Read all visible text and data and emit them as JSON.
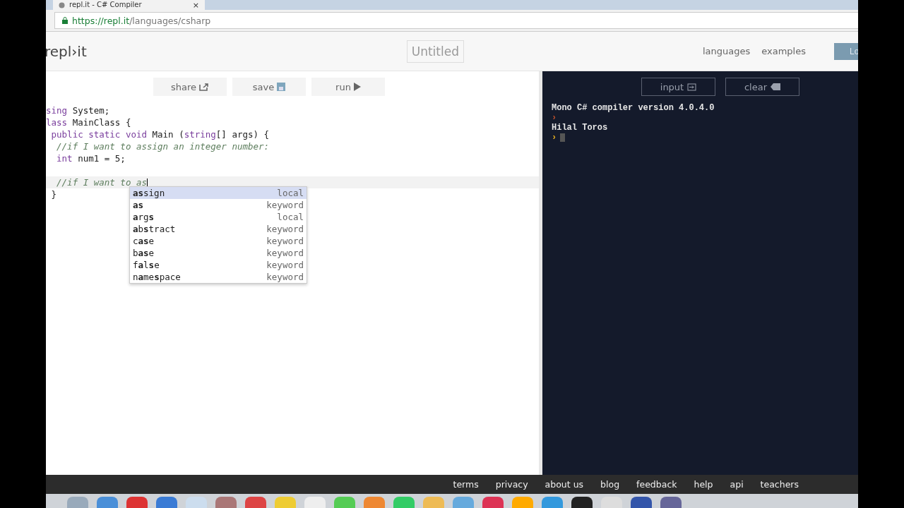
{
  "browser": {
    "tab_title": "repl.it - C# Compiler",
    "tab_close": "×",
    "url_host": "https://repl.it",
    "url_path": "/languages/csharp"
  },
  "header": {
    "logo": "repl›it",
    "title": "Untitled",
    "nav": [
      "languages",
      "examples"
    ],
    "login": "Lo"
  },
  "toolbar": [
    "share",
    "save",
    "run"
  ],
  "editor": {
    "lines": [
      {
        "kind": "code",
        "active": false,
        "tokens": [
          {
            "text": "sing",
            "kind": "keyword"
          },
          {
            "text": " System;",
            "kind": "plain"
          }
        ]
      },
      {
        "kind": "code",
        "active": false,
        "tokens": [
          {
            "text": "lass",
            "kind": "keyword"
          },
          {
            "text": " MainClass {",
            "kind": "plain"
          }
        ]
      },
      {
        "kind": "code",
        "active": false,
        "tokens": [
          {
            "text": " public static void",
            "kind": "keyword"
          },
          {
            "text": " Main (",
            "kind": "plain"
          },
          {
            "text": "string",
            "kind": "type"
          },
          {
            "text": "[] args) {",
            "kind": "plain"
          }
        ]
      },
      {
        "kind": "code",
        "active": false,
        "tokens": [
          {
            "text": "  //if I want to assign an integer number:",
            "kind": "comment"
          }
        ]
      },
      {
        "kind": "code",
        "active": false,
        "tokens": [
          {
            "text": "  int",
            "kind": "keyword"
          },
          {
            "text": " num1 = 5;",
            "kind": "plain"
          }
        ]
      },
      {
        "kind": "blank",
        "active": false
      },
      {
        "kind": "code",
        "active": true,
        "tokens": [
          {
            "text": "  //if I want to as",
            "kind": "comment"
          }
        ]
      },
      {
        "kind": "code",
        "active": false,
        "tokens": [
          {
            "text": " }",
            "kind": "plain"
          }
        ]
      }
    ],
    "completions": [
      {
        "label": "**as**sign",
        "type": "local",
        "selected": true
      },
      {
        "label": "**as**",
        "type": "keyword",
        "selected": false
      },
      {
        "label": "**a**rg**s**",
        "type": "local",
        "selected": false
      },
      {
        "label": "**a**b**s**tract",
        "type": "keyword",
        "selected": false
      },
      {
        "label": "c**as**e",
        "type": "keyword",
        "selected": false
      },
      {
        "label": "b**as**e",
        "type": "keyword",
        "selected": false
      },
      {
        "label": "f**a**l**s**e",
        "type": "keyword",
        "selected": false
      },
      {
        "label": "n**a**me**s**pace",
        "type": "keyword",
        "selected": false
      }
    ]
  },
  "console": {
    "buttons": [
      "input",
      "clear"
    ],
    "lines": [
      {
        "kind": "output",
        "text": "Mono C# compiler version 4.0.4.0"
      },
      {
        "kind": "prompt",
        "text": "›"
      },
      {
        "kind": "output",
        "text": "Hilal Toros"
      },
      {
        "kind": "cursor",
        "text": "›"
      }
    ]
  },
  "footer": [
    "terms",
    "privacy",
    "about us",
    "blog",
    "feedback",
    "help",
    "api",
    "teachers"
  ]
}
